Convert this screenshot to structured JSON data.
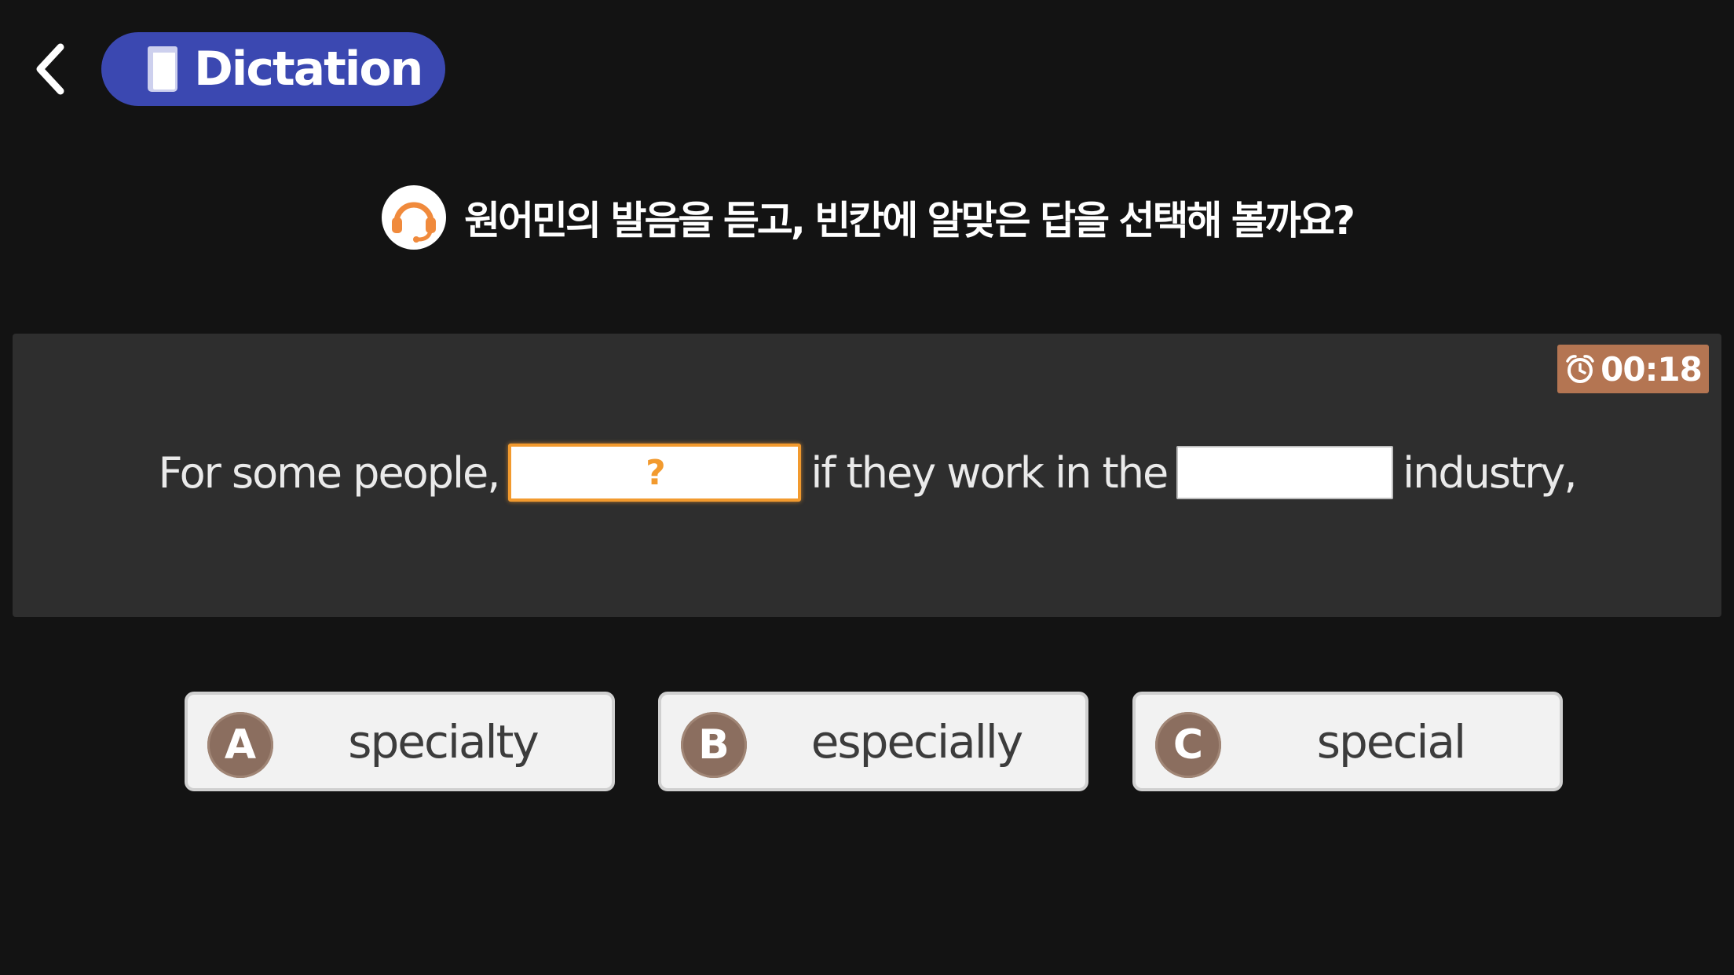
{
  "header": {
    "back_icon": "chevron-left-icon",
    "title": "Dictation",
    "title_icon": "book-icon",
    "accent_color": "#3b48b1"
  },
  "instruction": {
    "icon": "headset-icon",
    "text": "원어민의 발음을 듣고, 빈칸에 알맞은 답을 선택해 볼까요?"
  },
  "question": {
    "timer": "00:18",
    "timer_icon": "alarm-clock-icon",
    "timer_color": "#b47552",
    "segments": [
      "For some people,",
      "if they work in the",
      "industry,"
    ],
    "active_blank_mark": "?",
    "highlight_color": "#f29a2e"
  },
  "options": [
    {
      "letter": "A",
      "text": "specialty"
    },
    {
      "letter": "B",
      "text": "especially"
    },
    {
      "letter": "C",
      "text": "special"
    }
  ]
}
